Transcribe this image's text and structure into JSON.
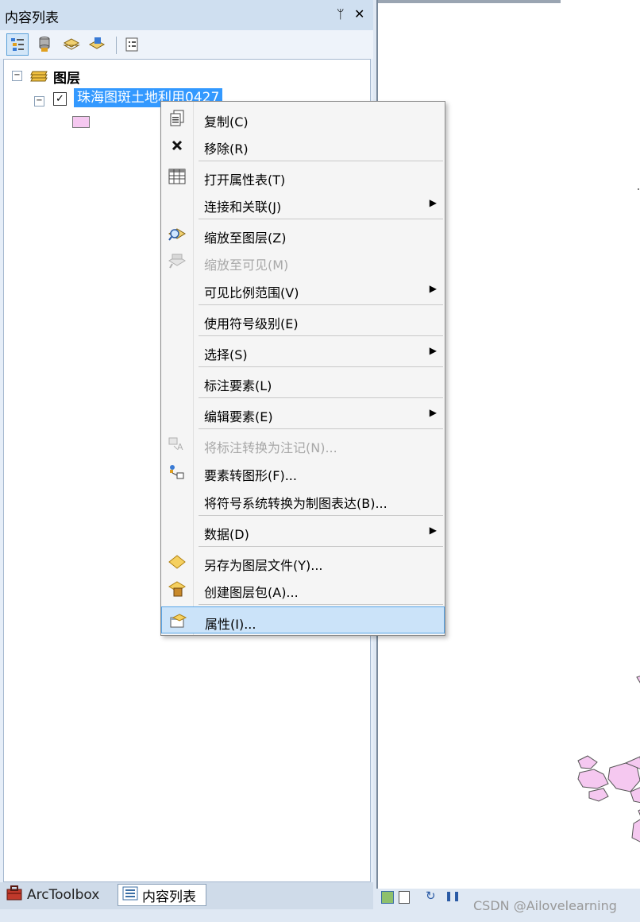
{
  "toc": {
    "title": "内容列表",
    "pin": "ᛘ",
    "close": "✕",
    "root_label": "图层",
    "layer_label": "珠海图斑土地利用0427"
  },
  "context_menu": {
    "items": [
      {
        "label": "复制(C)",
        "icon": "copy-icon",
        "enabled": true,
        "submenu": false
      },
      {
        "label": "移除(R)",
        "icon": "remove-icon",
        "enabled": true,
        "submenu": false
      },
      {
        "label": "打开属性表(T)",
        "icon": "table-icon",
        "enabled": true,
        "submenu": false
      },
      {
        "label": "连接和关联(J)",
        "icon": "",
        "enabled": true,
        "submenu": true
      },
      {
        "label": "缩放至图层(Z)",
        "icon": "zoom-to-layer-icon",
        "enabled": true,
        "submenu": false
      },
      {
        "label": "缩放至可见(M)",
        "icon": "zoom-to-visible-icon",
        "enabled": false,
        "submenu": false
      },
      {
        "label": "可见比例范围(V)",
        "icon": "",
        "enabled": true,
        "submenu": true
      },
      {
        "label": "使用符号级别(E)",
        "icon": "",
        "enabled": true,
        "submenu": false
      },
      {
        "label": "选择(S)",
        "icon": "",
        "enabled": true,
        "submenu": true
      },
      {
        "label": "标注要素(L)",
        "icon": "",
        "enabled": true,
        "submenu": false
      },
      {
        "label": "编辑要素(E)",
        "icon": "",
        "enabled": true,
        "submenu": true
      },
      {
        "label": "将标注转换为注记(N)...",
        "icon": "convert-labels-icon",
        "enabled": false,
        "submenu": false
      },
      {
        "label": "要素转图形(F)...",
        "icon": "features-to-graphics-icon",
        "enabled": true,
        "submenu": false
      },
      {
        "label": "将符号系统转换为制图表达(B)...",
        "icon": "",
        "enabled": true,
        "submenu": false
      },
      {
        "label": "数据(D)",
        "icon": "",
        "enabled": true,
        "submenu": true
      },
      {
        "label": "另存为图层文件(Y)...",
        "icon": "save-layer-icon",
        "enabled": true,
        "submenu": false
      },
      {
        "label": "创建图层包(A)...",
        "icon": "layer-package-icon",
        "enabled": true,
        "submenu": false
      },
      {
        "label": "属性(I)...",
        "icon": "properties-icon",
        "enabled": true,
        "submenu": false,
        "highlighted": true
      }
    ]
  },
  "bottom_tabs": {
    "arctoolbox": "ArcToolbox",
    "toc": "内容列表"
  },
  "watermark": "CSDN @Ailovelearning",
  "colors": {
    "selection": "#3399ff",
    "polygon_fill": "#f5c8f0",
    "highlight": "#cbe3f9"
  }
}
